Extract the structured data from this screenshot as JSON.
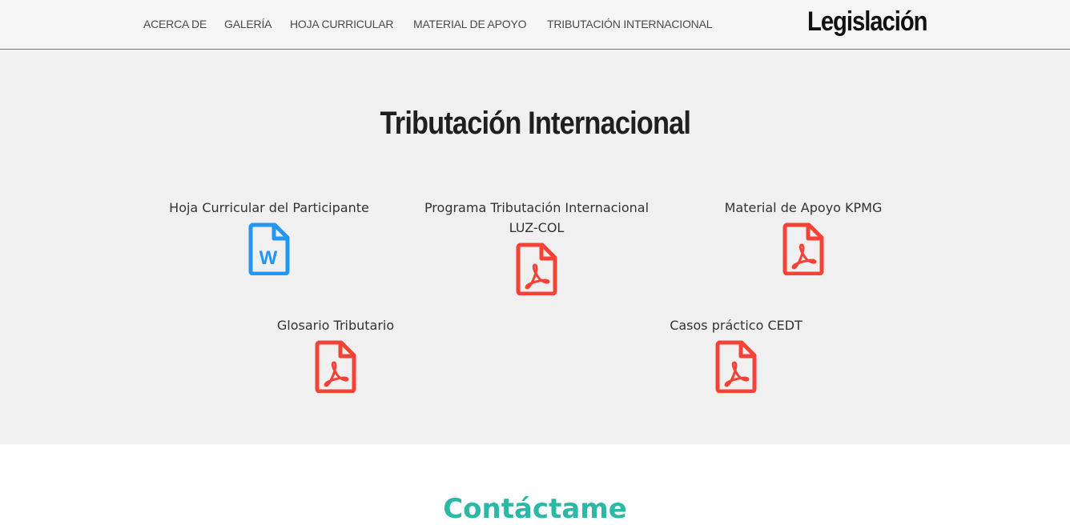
{
  "nav": {
    "items": [
      {
        "label": "ACERCA DE"
      },
      {
        "label": "GALERÍA"
      },
      {
        "label": "HOJA CURRICULAR"
      },
      {
        "label": "MATERIAL DE APOYO"
      },
      {
        "label": "TRIBUTACIÓN INTERNACIONAL"
      }
    ],
    "brand": "Legislación"
  },
  "section": {
    "title": "Tributación Internacional",
    "documents": [
      {
        "label": "Hoja Curricular del Participante",
        "icon": "word-file-icon",
        "color": "#2196f3"
      },
      {
        "label": "Programa Tributación Internacional LUZ-COL",
        "icon": "pdf-file-icon",
        "color": "#f44336"
      },
      {
        "label": "Material de Apoyo KPMG",
        "icon": "pdf-file-icon",
        "color": "#f44336"
      },
      {
        "label": "Glosario Tributario",
        "icon": "pdf-file-icon",
        "color": "#f44336"
      },
      {
        "label": "Casos práctico CEDT",
        "icon": "pdf-file-icon",
        "color": "#f44336"
      }
    ]
  },
  "contact": {
    "title": "Contáctame"
  }
}
